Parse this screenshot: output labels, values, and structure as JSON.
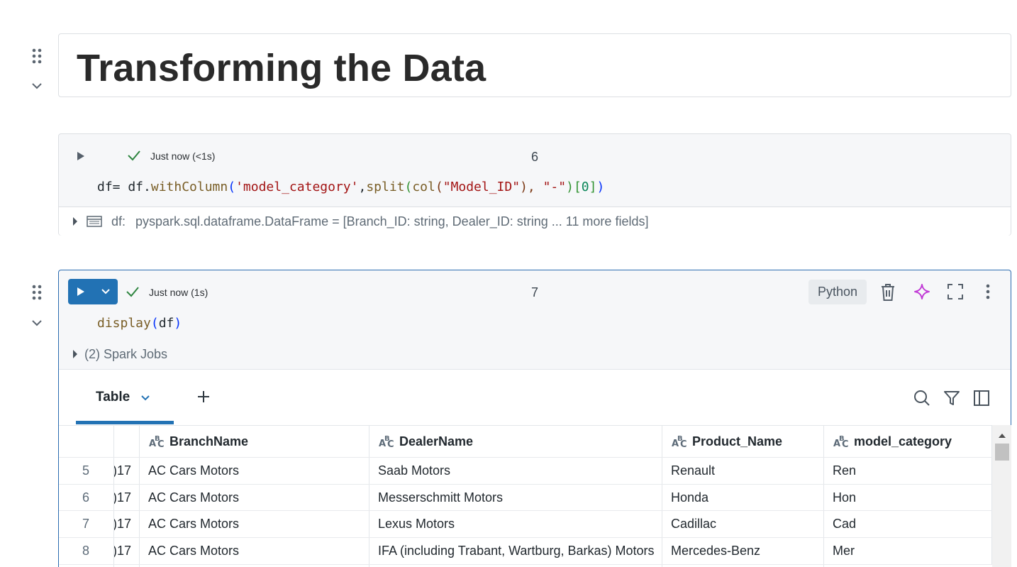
{
  "markdown_cell": {
    "title": "Transforming the Data"
  },
  "cell6": {
    "status": "Just now (<1s)",
    "execution_count": "6",
    "code": {
      "t1": "df= df.",
      "t2": "withColumn",
      "t3": "(",
      "t4": "'model_category'",
      "t5": ",",
      "t6": "split",
      "t7": "(",
      "t8": "col",
      "t9": "(",
      "t10": "\"Model_ID\"",
      "t11": "), ",
      "t12": "\"-\"",
      "t13": ")",
      "t14": "[",
      "t15": "0",
      "t16": "]",
      "t17": ")"
    },
    "result": {
      "var_name": "df:",
      "schema": "pyspark.sql.dataframe.DataFrame = [Branch_ID: string, Dealer_ID: string ... 11 more fields]"
    }
  },
  "cell7": {
    "status": "Just now (1s)",
    "execution_count": "7",
    "language": "Python",
    "code": {
      "t1": "display",
      "t2": "(",
      "t3": "df",
      "t4": ")"
    },
    "spark_jobs": "(2) Spark Jobs",
    "output": {
      "active_tab": "Table",
      "columns": [
        "",
        "BranchName",
        "DealerName",
        "Product_Name",
        "model_category"
      ],
      "rows": [
        {
          "num": "5",
          "partial": ")17",
          "branch": "AC Cars Motors",
          "dealer": "Saab Motors",
          "product": "Renault",
          "category": "Ren"
        },
        {
          "num": "6",
          "partial": ")17",
          "branch": "AC Cars Motors",
          "dealer": "Messerschmitt Motors",
          "product": "Honda",
          "category": "Hon"
        },
        {
          "num": "7",
          "partial": ")17",
          "branch": "AC Cars Motors",
          "dealer": "Lexus Motors",
          "product": "Cadillac",
          "category": "Cad"
        },
        {
          "num": "8",
          "partial": ")17",
          "branch": "AC Cars Motors",
          "dealer": "IFA (including Trabant, Wartburg, Barkas) Motors",
          "product": "Mercedes-Benz",
          "category": "Mer"
        }
      ]
    }
  },
  "colors": {
    "accent": "#2272b4",
    "success": "#2e8540",
    "assistant_magenta": "#c13ad6"
  }
}
